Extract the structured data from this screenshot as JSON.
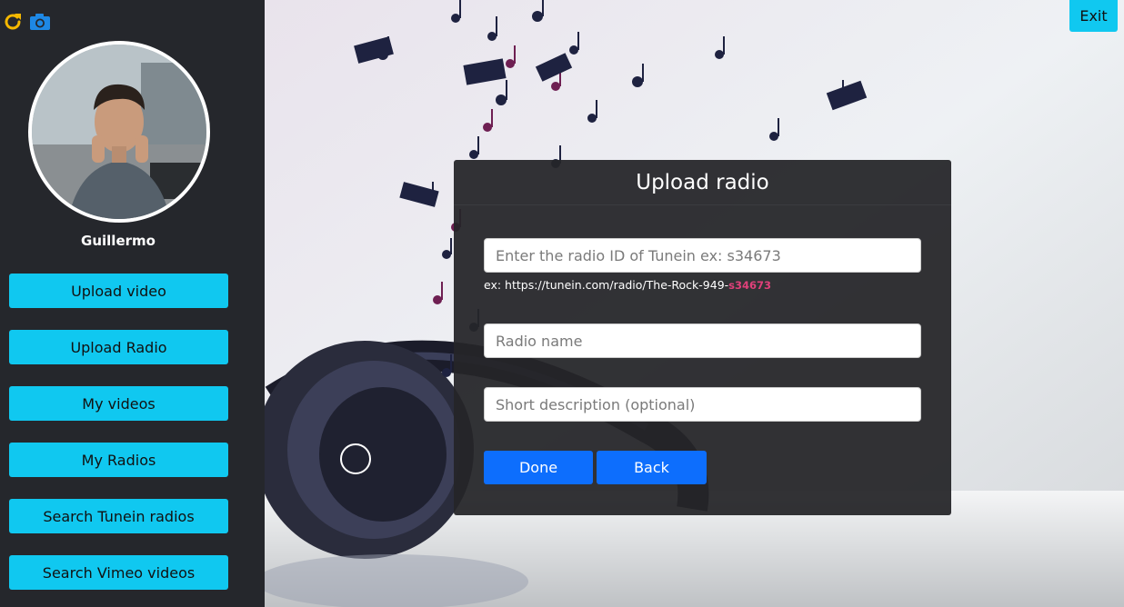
{
  "sidebar": {
    "icons": [
      "refresh-icon",
      "camera-icon"
    ],
    "username": "Guillermo",
    "buttons": [
      {
        "label": "Upload video"
      },
      {
        "label": "Upload Radio"
      },
      {
        "label": "My videos"
      },
      {
        "label": "My Radios"
      },
      {
        "label": "Search Tunein radios"
      },
      {
        "label": "Search Vimeo videos"
      }
    ]
  },
  "header": {
    "exit_label": "Exit"
  },
  "modal": {
    "title": "Upload radio",
    "radio_id": {
      "placeholder": "Enter the radio ID of Tunein ex: s34673",
      "value": ""
    },
    "hint_prefix": "ex: https://tunein.com/radio/The-Rock-949-",
    "hint_id": "s34673",
    "radio_name": {
      "placeholder": "Radio name",
      "value": ""
    },
    "description": {
      "placeholder": "Short description (optional)",
      "value": ""
    },
    "done_label": "Done",
    "back_label": "Back"
  },
  "colors": {
    "sidebar_bg": "#25272c",
    "accent_cyan": "#10c8f0",
    "primary_blue": "#0d6efd",
    "hint_highlight": "#e0407a",
    "refresh_icon": "#f5b800",
    "camera_icon": "#1e88e5"
  }
}
